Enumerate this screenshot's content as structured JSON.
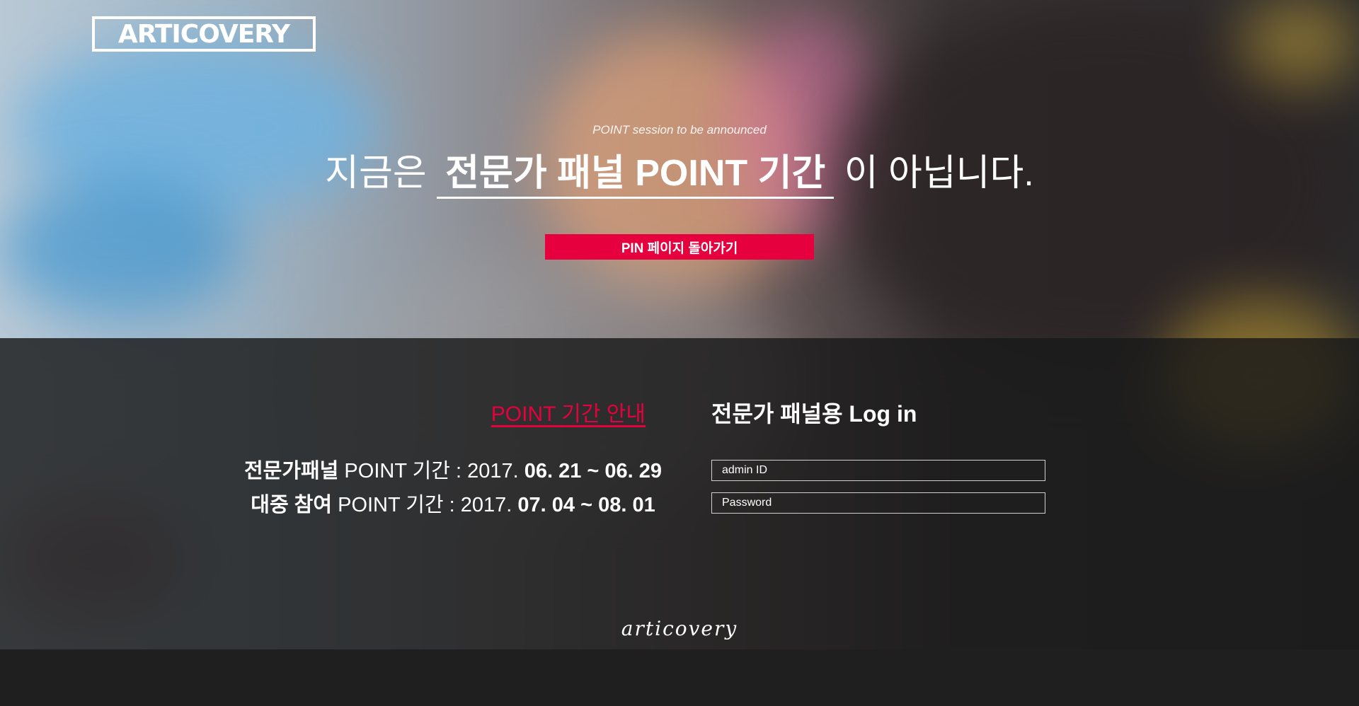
{
  "brand": {
    "logo_text": "ARTICOVERY",
    "footer_logo": "articovery"
  },
  "hero": {
    "subtitle": "POINT session to be announced",
    "headline_prefix": "지금은",
    "headline_highlight": "전문가 패널 POINT 기간",
    "headline_suffix": "이 아닙니다.",
    "pin_button_label": "PIN 페이지 돌아가기"
  },
  "info": {
    "title": "POINT 기간 안내",
    "periods": [
      {
        "label": "전문가패널",
        "text": " POINT 기간 : 2017. ",
        "dates": "06. 21 ~ 06. 29"
      },
      {
        "label": "대중 참여",
        "text": " POINT 기간 : 2017. ",
        "dates": "07. 04 ~ 08. 01"
      }
    ]
  },
  "login": {
    "title": "전문가 패널용 Log in",
    "id_placeholder": "admin ID",
    "password_placeholder": "Password"
  },
  "colors": {
    "accent": "#e6003d",
    "overlay": "#1a1a1a"
  }
}
